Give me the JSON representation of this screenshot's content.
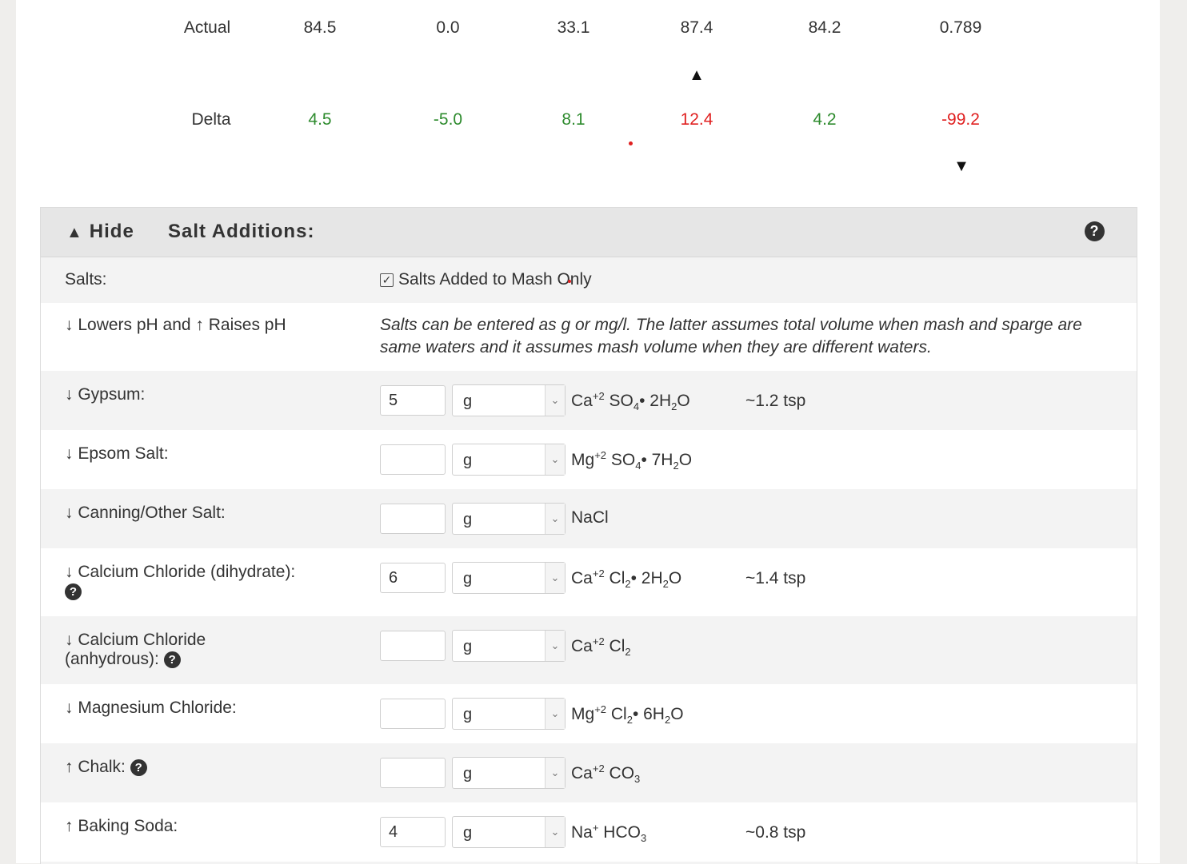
{
  "summary": {
    "actual": {
      "label": "Actual",
      "values": [
        "84.5",
        "0.0",
        "33.1",
        "87.4",
        "84.2",
        "0.789"
      ]
    },
    "delta": {
      "label": "Delta",
      "values": [
        "4.5",
        "-5.0",
        "8.1",
        "12.4",
        "4.2",
        "-99.2"
      ],
      "status": [
        "ok",
        "ok",
        "ok",
        "high",
        "ok",
        "low"
      ]
    },
    "indicators": {
      "up_arrow": "▲",
      "down_arrow": "▼"
    }
  },
  "colors": {
    "ok": "#2e8b2e",
    "warning": "#e02020"
  },
  "panel": {
    "hide_label": "Hide",
    "hide_icon": "▲",
    "title": "Salt Additions:",
    "help": "?",
    "salts_label": "Salts:",
    "mash_only_label": "Salts Added to Mash Only",
    "mash_only_checked": "☑",
    "legend_label": "↓ Lowers pH and ↑ Raises pH",
    "note": "Salts can be entered as g or mg/l. The latter assumes total volume when mash and sparge are same waters and it assumes mash volume when they are different waters."
  },
  "salts": [
    {
      "name": "↓ Gypsum:",
      "amount": "5",
      "unit": "g",
      "tsp": "~1.2 tsp"
    },
    {
      "name": "↓ Epsom Salt:",
      "amount": "",
      "unit": "g",
      "tsp": ""
    },
    {
      "name": "↓ Canning/Other Salt:",
      "amount": "",
      "unit": "g",
      "tsp": ""
    },
    {
      "name": "↓ Calcium Chloride (dihydrate):",
      "amount": "6",
      "unit": "g",
      "tsp": "~1.4 tsp"
    },
    {
      "name": "↓ Calcium Chloride",
      "name2": "(anhydrous):",
      "amount": "",
      "unit": "g",
      "tsp": ""
    },
    {
      "name": "↓ Magnesium Chloride:",
      "amount": "",
      "unit": "g",
      "tsp": ""
    },
    {
      "name": "↑ Chalk:",
      "amount": "",
      "unit": "g",
      "tsp": ""
    },
    {
      "name": "↑ Baking Soda:",
      "amount": "4",
      "unit": "g",
      "tsp": "~0.8 tsp"
    }
  ],
  "formulas": {
    "gypsum": {
      "a": "Ca",
      "a_sup": "+2",
      "b": "SO",
      "b_sub": "4",
      "c": "• 2H",
      "c_sub": "2",
      "d": "O"
    },
    "epsom": {
      "a": "Mg",
      "a_sup": "+2",
      "b": "SO",
      "b_sub": "4",
      "c": "• 7H",
      "c_sub": "2",
      "d": "O"
    },
    "nacl": {
      "a": "NaCl"
    },
    "cacl2_dihydrate": {
      "a": "Ca",
      "a_sup": "+2",
      "b": "Cl",
      "b_sub": "2",
      "c": "• 2H",
      "c_sub": "2",
      "d": "O"
    },
    "cacl2": {
      "a": "Ca",
      "a_sup": "+2",
      "b": "Cl",
      "b_sub": "2"
    },
    "mgcl2": {
      "a": "Mg",
      "a_sup": "+2",
      "b": "Cl",
      "b_sub": "2",
      "c": "• 6H",
      "c_sub": "2",
      "d": "O"
    },
    "chalk": {
      "a": "Ca",
      "a_sup": "+2",
      "b": "CO",
      "b_sub": "3"
    },
    "baking_soda": {
      "a": "Na",
      "a_sup": "+",
      "b": "HCO",
      "b_sub": "3"
    }
  }
}
